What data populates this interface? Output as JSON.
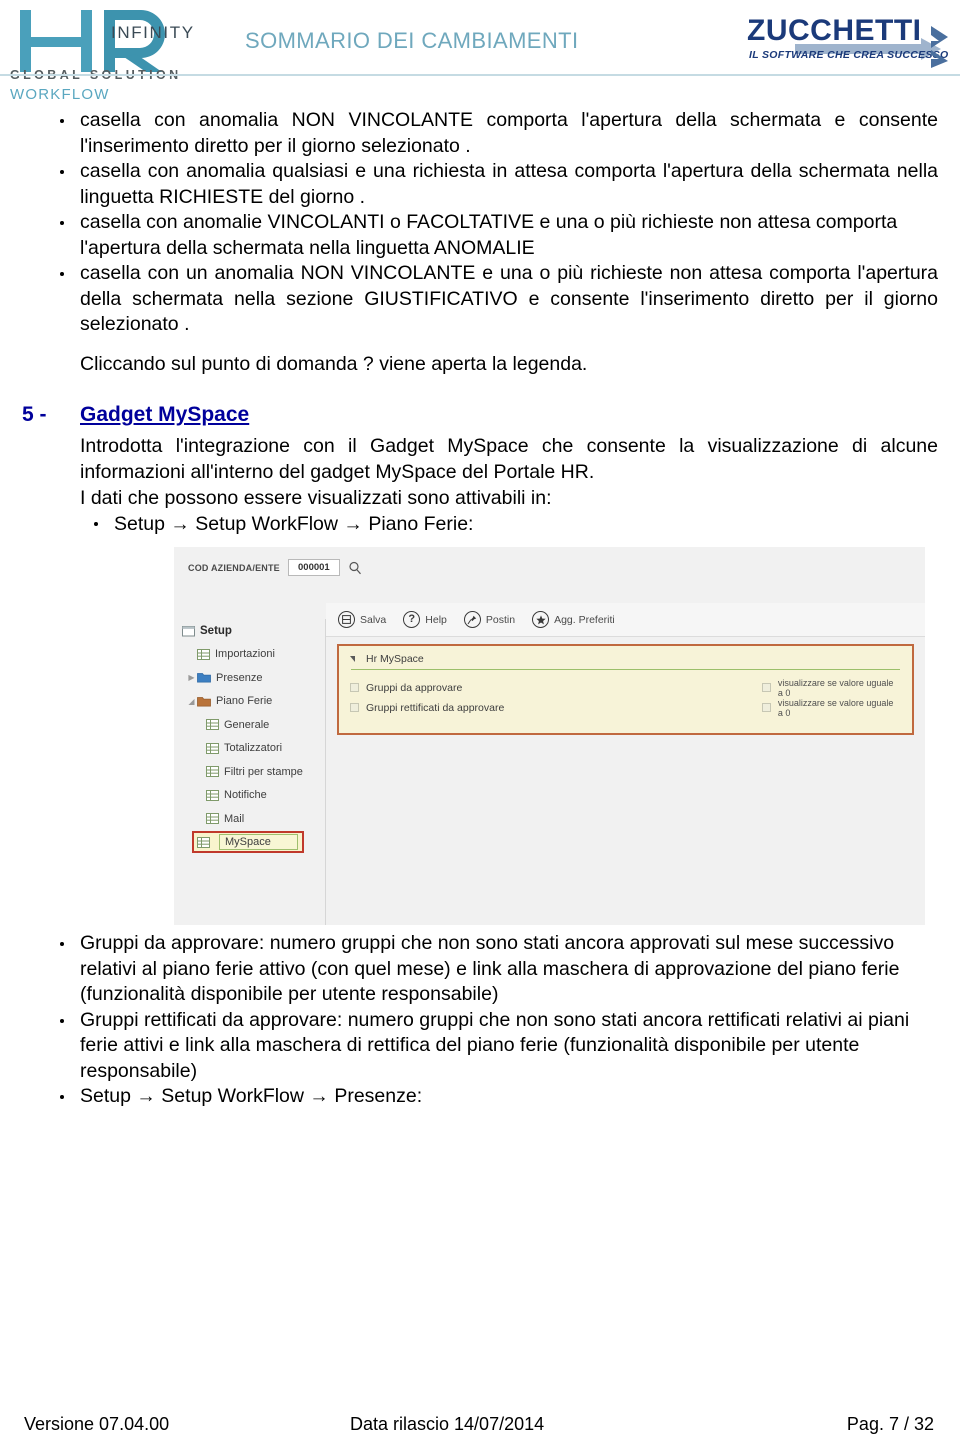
{
  "header": {
    "logo_main": "HR",
    "logo_infinity": "INFINITY",
    "logo_global": "GLOBAL SOLUTION",
    "logo_workflow": "WORKFLOW",
    "title": "SOMMARIO DEI CAMBIAMENTI",
    "brand_name": "ZUCCHETTI",
    "brand_tagline": "IL SOFTWARE CHE CREA SUCCESSO",
    "colors": {
      "teal": "#6fa8bd",
      "logo_blue": "#4aa0bb",
      "brand_navy": "#1b3a7a",
      "rule": "#c5dbe3"
    }
  },
  "top_bullets": [
    "casella con anomalia NON VINCOLANTE comporta l'apertura della schermata e consente l'inserimento diretto per il giorno selezionato .",
    "casella con anomalia qualsiasi e una richiesta in attesa comporta l'apertura della schermata nella linguetta RICHIESTE del giorno .",
    "casella con anomalie VINCOLANTI o FACOLTATIVE e una o più richieste non attesa comporta l'apertura della schermata nella linguetta ANOMALIE",
    "casella con un anomalia NON VINCOLANTE e una o più richieste non attesa comporta l'apertura della schermata nella sezione GIUSTIFICATIVO e consente l'inserimento diretto per il giorno selezionato ."
  ],
  "legend_note": "Cliccando sul punto di domanda ? viene aperta la legenda.",
  "section": {
    "number": "5 -",
    "title": "Gadget MySpace",
    "color": "#00009b",
    "paragraph_1": "Introdotta l'integrazione con il Gadget MySpace che consente la visualizzazione di alcune informazioni all'interno del gadget MySpace del Portale HR.",
    "paragraph_2": "I dati che possono essere visualizzati sono attivabili in:",
    "path_bullet": "Setup → Setup WorkFlow → Piano Ferie:"
  },
  "app_screenshot": {
    "cod_label": "COD AZIENDA/ENTE",
    "cod_value": "000001",
    "search_icon": "magnifier-icon",
    "toolbar": [
      {
        "label": "Salva",
        "icon": "save-icon",
        "glyph": "▤"
      },
      {
        "label": "Help",
        "icon": "help-icon",
        "glyph": "?"
      },
      {
        "label": "Postin",
        "icon": "pin-icon",
        "glyph": "✶"
      },
      {
        "label": "Agg. Preferiti",
        "icon": "star-icon",
        "glyph": "★"
      }
    ],
    "tree": [
      {
        "label": "Setup",
        "level": 0,
        "twisty": "",
        "icon": "setup-icon",
        "selected": false
      },
      {
        "label": "Importazioni",
        "level": 1,
        "twisty": "",
        "icon": "grid-icon",
        "selected": false
      },
      {
        "label": "Presenze",
        "level": 1,
        "twisty": "▶",
        "icon": "folder-icon",
        "selected": false
      },
      {
        "label": "Piano Ferie",
        "level": 1,
        "twisty": "◢",
        "icon": "folder-open-icon",
        "selected": false
      },
      {
        "label": "Generale",
        "level": 2,
        "twisty": "",
        "icon": "grid-icon",
        "selected": false
      },
      {
        "label": "Totalizzatori",
        "level": 2,
        "twisty": "",
        "icon": "grid-icon",
        "selected": false
      },
      {
        "label": "Filtri per stampe",
        "level": 2,
        "twisty": "",
        "icon": "grid-icon",
        "selected": false
      },
      {
        "label": "Notifiche",
        "level": 2,
        "twisty": "",
        "icon": "grid-icon",
        "selected": false
      },
      {
        "label": "Mail",
        "level": 2,
        "twisty": "",
        "icon": "grid-icon",
        "selected": false
      },
      {
        "label": "MySpace",
        "level": 2,
        "twisty": "",
        "icon": "grid-icon",
        "selected": true
      }
    ],
    "panel": {
      "title": "Hr MySpace",
      "rows": [
        {
          "label": "Gruppi da approvare",
          "checked": false,
          "option_label": "visualizzare se valore uguale a 0",
          "option_checked": false
        },
        {
          "label": "Gruppi rettificati da approvare",
          "checked": false,
          "option_label": "visualizzare se valore uguale a 0",
          "option_checked": false
        }
      ]
    },
    "colors": {
      "panel_bg": "#f7f3d8",
      "panel_border": "#c0693f",
      "selection_border": "#c0392b",
      "rule_green": "#9cbf6a"
    }
  },
  "bottom_bullets": [
    "Gruppi da approvare: numero gruppi che non sono stati ancora approvati sul mese successivo relativi al piano ferie attivo (con quel mese) e link alla maschera di approvazione del piano ferie (funzionalità disponibile per utente responsabile)",
    "Gruppi rettificati da approvare: numero gruppi che non sono stati ancora rettificati relativi ai piani ferie attivi e link alla maschera di rettifica del piano ferie (funzionalità disponibile per utente responsabile)",
    "Setup → Setup WorkFlow → Presenze:"
  ],
  "footer": {
    "version": "Versione 07.04.00",
    "release": "Data rilascio 14/07/2014",
    "page": "Pag. 7 / 32"
  }
}
